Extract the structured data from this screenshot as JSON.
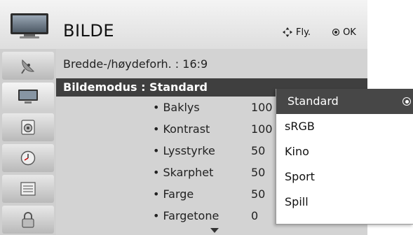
{
  "header": {
    "title": "BILDE",
    "nav_hint": "Fly.",
    "ok_hint": "OK"
  },
  "sidebar": {
    "items": [
      {
        "icon": "satellite-dish-icon"
      },
      {
        "icon": "tv-picture-icon",
        "active": true
      },
      {
        "icon": "speaker-audio-icon"
      },
      {
        "icon": "clock-time-icon"
      },
      {
        "icon": "options-icon"
      },
      {
        "icon": "lock-icon"
      }
    ]
  },
  "picture_menu": {
    "aspect_ratio": "Bredde-/høydeforh. : 16:9",
    "picture_mode": "Bildemodus : Standard",
    "settings": [
      {
        "label": "Baklys",
        "value": "100"
      },
      {
        "label": "Kontrast",
        "value": "100"
      },
      {
        "label": "Lysstyrke",
        "value": "50"
      },
      {
        "label": "Skarphet",
        "value": "50"
      },
      {
        "label": "Farge",
        "value": "50"
      },
      {
        "label": "Fargetone",
        "value": "0"
      }
    ]
  },
  "mode_dropdown": {
    "options": [
      "Standard",
      "sRGB",
      "Kino",
      "Sport",
      "Spill"
    ],
    "selected": "Standard"
  },
  "colors": {
    "highlight_bar": "#3f3f3f",
    "panel_bg": "#d3d3d3",
    "dropdown_bg": "#ffffff"
  }
}
